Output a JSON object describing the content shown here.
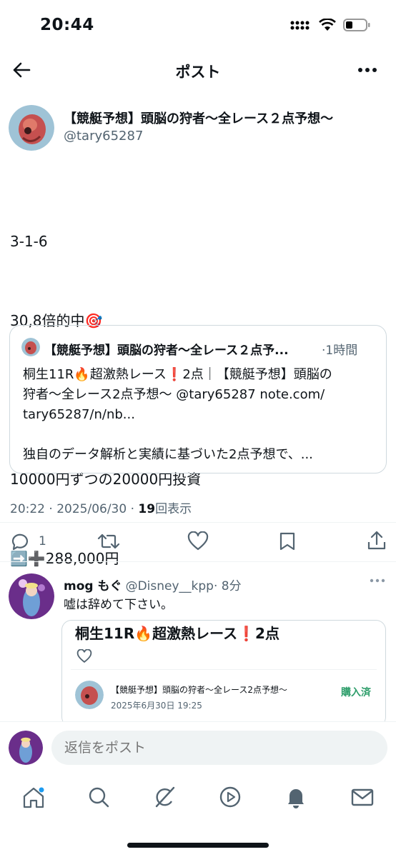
{
  "status_bar": {
    "time": "20:44"
  },
  "header": {
    "title": "ポスト"
  },
  "post": {
    "author_name": "【競艇予想】頭脳の狩者〜全レース２点予想〜",
    "author_handle": "@tary65287",
    "text_lines": [
      "3-1-6",
      "30,8倍的中🎯",
      "",
      "10000円ずつの20000円投資",
      "➡️➕288,000円"
    ],
    "quote": {
      "author_name": "【競艇予想】頭脳の狩者〜全レース２点予...",
      "time": "1時間",
      "line1": "桐生11R🔥超激熱レース❗️2点｜【競艇予想】頭脳の",
      "line2": "狩者〜全レース2点予想〜 @tary65287 note.com/",
      "line3": "tary65287/n/nb...",
      "line4": "独自のデータ解析と実績に基づいた2点予想で、..."
    },
    "timestamp": "20:22 · 2025/06/30 · ",
    "views_count": "19",
    "views_label": "回表示",
    "reply_count": "1"
  },
  "reply": {
    "name": "mog もぐ",
    "handle": "@Disney__kpp",
    "time": "· 8分",
    "text": "嘘は辞めて下さい。",
    "card": {
      "title": "桐生11R🔥超激熱レース❗️2点",
      "author": "【競艇予想】頭脳の狩者〜全レース2点予想〜",
      "date": "2025年6月30日 19:25",
      "badge": "購入済"
    }
  },
  "compose": {
    "placeholder": "返信をポスト"
  },
  "colors": {
    "text": "#0f1419",
    "secondary": "#536471",
    "border": "#cfd9de",
    "badge_green": "#2e9e6b",
    "accent": "#1d9bf0"
  },
  "icons": [
    "back-arrow-icon",
    "more-icon",
    "reply-icon",
    "repost-icon",
    "like-icon",
    "bookmark-icon",
    "share-icon",
    "home-icon",
    "search-icon",
    "grok-icon",
    "video-icon",
    "bell-icon",
    "mail-icon"
  ]
}
